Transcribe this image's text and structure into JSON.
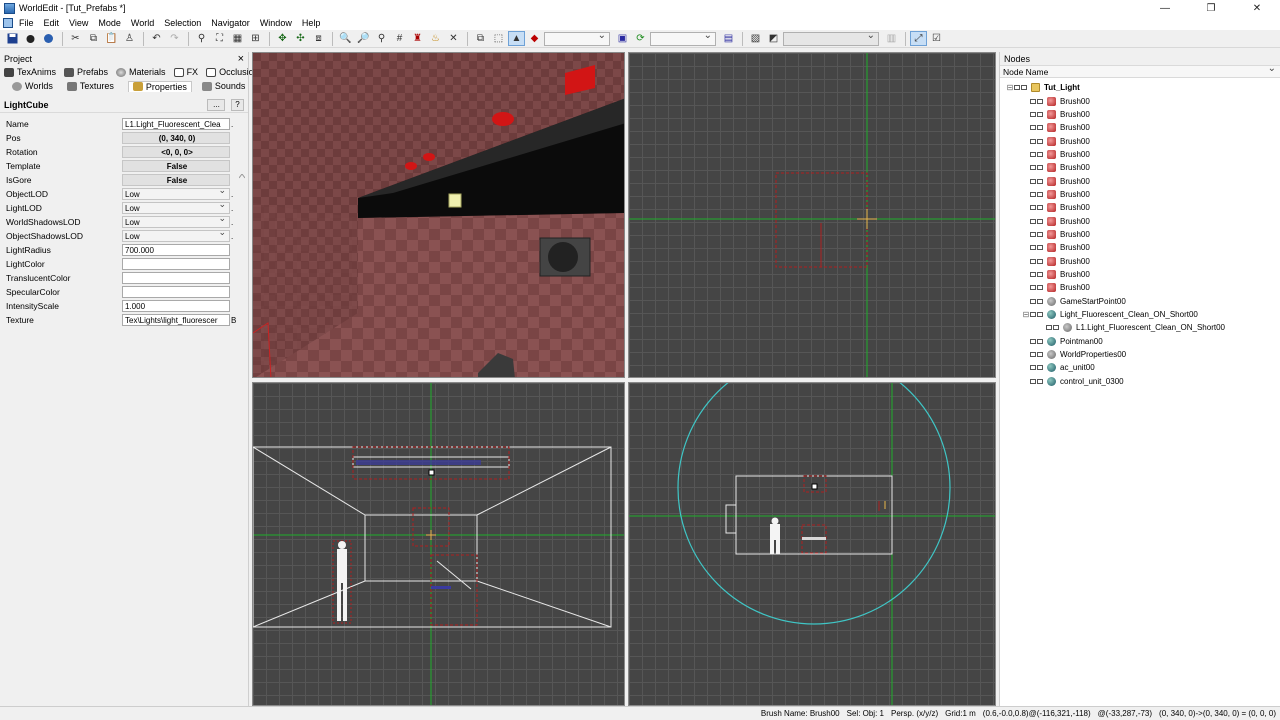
{
  "window": {
    "title": "WorldEdit - [Tut_Prefabs *]",
    "controls": [
      "—",
      "❐",
      "✕"
    ]
  },
  "menu": [
    "File",
    "Edit",
    "View",
    "Mode",
    "World",
    "Selection",
    "Navigator",
    "Window",
    "Help"
  ],
  "project_panel": {
    "title": "Project",
    "close": "×",
    "tabs_row1": [
      {
        "label": "TexAnims",
        "icon": "texanims-icon"
      },
      {
        "label": "Prefabs",
        "icon": "prefabs-icon"
      },
      {
        "label": "Materials",
        "icon": "materials-icon"
      },
      {
        "label": "FX",
        "icon": "fx-icon"
      },
      {
        "label": "Occlusion",
        "icon": "occlusion-icon"
      }
    ],
    "tabs_row2": [
      {
        "label": "Worlds",
        "icon": "worlds-icon"
      },
      {
        "label": "Textures",
        "icon": "textures-icon"
      },
      {
        "label": "Properties",
        "icon": "properties-icon"
      },
      {
        "label": "Sounds",
        "icon": "sounds-icon"
      }
    ],
    "object_name": "LightCube",
    "dots_button": "...",
    "help_button": "?",
    "properties": [
      {
        "label": "Name",
        "value": "L1.Light_Fluorescent_Clea",
        "kind": "text",
        "extra": "."
      },
      {
        "label": "Pos",
        "value": "(0, 340, 0)",
        "kind": "button",
        "extra": ""
      },
      {
        "label": "Rotation",
        "value": "<0, 0, 0>",
        "kind": "button",
        "extra": ""
      },
      {
        "label": "Template",
        "value": "False",
        "kind": "button",
        "extra": ""
      },
      {
        "label": "IsGore",
        "value": "False",
        "kind": "button",
        "extra": ""
      },
      {
        "label": "ObjectLOD",
        "value": "Low",
        "kind": "combo",
        "extra": "."
      },
      {
        "label": "LightLOD",
        "value": "Low",
        "kind": "combo",
        "extra": "."
      },
      {
        "label": "WorldShadowsLOD",
        "value": "Low",
        "kind": "combo",
        "extra": "."
      },
      {
        "label": "ObjectShadowsLOD",
        "value": "Low",
        "kind": "combo",
        "extra": "."
      },
      {
        "label": "LightRadius",
        "value": "700.000",
        "kind": "text",
        "extra": ""
      },
      {
        "label": "LightColor",
        "value": "",
        "kind": "text",
        "extra": ""
      },
      {
        "label": "TranslucentColor",
        "value": "",
        "kind": "text",
        "extra": ""
      },
      {
        "label": "SpecularColor",
        "value": "",
        "kind": "text",
        "extra": ""
      },
      {
        "label": "IntensityScale",
        "value": "1.000",
        "kind": "text",
        "extra": ""
      },
      {
        "label": "Texture",
        "value": "Tex\\Lights\\light_fluorescer",
        "kind": "text",
        "extra": "B"
      }
    ]
  },
  "nodes_panel": {
    "title": "Nodes",
    "column": "Node Name",
    "items": [
      {
        "name": "Tut_Light",
        "icon": "folder",
        "depth": 0,
        "expander": "⊟",
        "bold": true
      },
      {
        "name": "Brush00",
        "icon": "brush",
        "depth": 1,
        "expander": "",
        "bold": false
      },
      {
        "name": "Brush00",
        "icon": "brush",
        "depth": 1,
        "expander": "",
        "bold": false
      },
      {
        "name": "Brush00",
        "icon": "brush",
        "depth": 1,
        "expander": "",
        "bold": false
      },
      {
        "name": "Brush00",
        "icon": "brush",
        "depth": 1,
        "expander": "",
        "bold": false
      },
      {
        "name": "Brush00",
        "icon": "brush",
        "depth": 1,
        "expander": "",
        "bold": false
      },
      {
        "name": "Brush00",
        "icon": "brush",
        "depth": 1,
        "expander": "",
        "bold": false
      },
      {
        "name": "Brush00",
        "icon": "brush",
        "depth": 1,
        "expander": "",
        "bold": false
      },
      {
        "name": "Brush00",
        "icon": "brush",
        "depth": 1,
        "expander": "",
        "bold": false
      },
      {
        "name": "Brush00",
        "icon": "brush",
        "depth": 1,
        "expander": "",
        "bold": false
      },
      {
        "name": "Brush00",
        "icon": "brush",
        "depth": 1,
        "expander": "",
        "bold": false
      },
      {
        "name": "Brush00",
        "icon": "brush",
        "depth": 1,
        "expander": "",
        "bold": false
      },
      {
        "name": "Brush00",
        "icon": "brush",
        "depth": 1,
        "expander": "",
        "bold": false
      },
      {
        "name": "Brush00",
        "icon": "brush",
        "depth": 1,
        "expander": "",
        "bold": false
      },
      {
        "name": "Brush00",
        "icon": "brush",
        "depth": 1,
        "expander": "",
        "bold": false
      },
      {
        "name": "Brush00",
        "icon": "brush",
        "depth": 1,
        "expander": "",
        "bold": false
      },
      {
        "name": "GameStartPoint00",
        "icon": "gear",
        "depth": 1,
        "expander": "",
        "bold": false
      },
      {
        "name": "Light_Fluorescent_Clean_ON_Short00",
        "icon": "globe",
        "depth": 1,
        "expander": "⊟",
        "bold": false
      },
      {
        "name": "L1.Light_Fluorescent_Clean_ON_Short00",
        "icon": "gear",
        "depth": 2,
        "expander": "",
        "bold": false
      },
      {
        "name": "Pointman00",
        "icon": "globe",
        "depth": 1,
        "expander": "",
        "bold": false
      },
      {
        "name": "WorldProperties00",
        "icon": "gear",
        "depth": 1,
        "expander": "",
        "bold": false
      },
      {
        "name": "ac_unit00",
        "icon": "globe",
        "depth": 1,
        "expander": "",
        "bold": false
      },
      {
        "name": "control_unit_0300",
        "icon": "globe",
        "depth": 1,
        "expander": "",
        "bold": false
      }
    ]
  },
  "status_bar": {
    "brush_name": "Brush Name: Brush00",
    "sel": "Sel: Obj: 1",
    "persp": "Persp. (x/y/z)",
    "grid": "Grid:1 m",
    "coords1": "(0.6,-0.0,0.8)@(-116,321,-118)",
    "coords2": "@(-33,287,-73)",
    "coords3": "(0, 340, 0)->(0, 340, 0) = (0, 0, 0)"
  },
  "colors": {
    "grid_bg": "#454545",
    "axis_green": "#1fae2a",
    "selection_red": "#b02020",
    "light_radius_cyan": "#3fc6c6",
    "wall_brick": "#7a4646"
  }
}
